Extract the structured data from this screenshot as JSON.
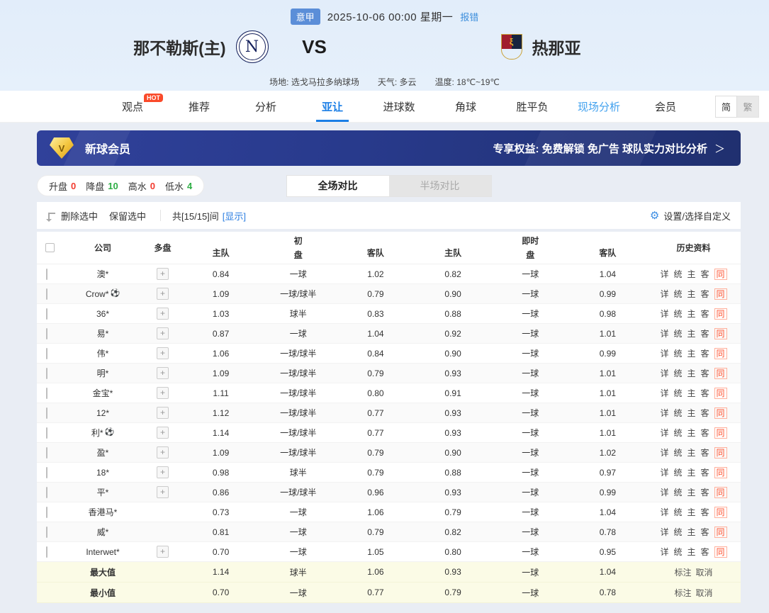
{
  "header": {
    "league_badge": "意甲",
    "match_time": "2025-10-06 00:00 星期一",
    "report_error": "报错",
    "home_team": "那不勒斯(主)",
    "home_logo_letter": "N",
    "vs": "VS",
    "away_team": "热那亚",
    "venue_label": "场地:",
    "venue": "选戈马拉多纳球场",
    "weather_label": "天气:",
    "weather": "多云",
    "temp_label": "温度:",
    "temperature": "18℃~19℃"
  },
  "nav": {
    "hot_badge": "HOT",
    "tabs": [
      {
        "label": "观点",
        "hot": true
      },
      {
        "label": "推荐"
      },
      {
        "label": "分析"
      },
      {
        "label": "亚让",
        "active": true
      },
      {
        "label": "进球数"
      },
      {
        "label": "角球"
      },
      {
        "label": "胜平负"
      },
      {
        "label": "现场分析",
        "highlight": true
      },
      {
        "label": "会员"
      }
    ],
    "lang_simplified": "简",
    "lang_traditional": "繁"
  },
  "banner": {
    "gem_letter": "V",
    "title": "新球会员",
    "benefits": "专享权益: 免费解锁 免广告 球队实力对比分析",
    "arrow": "＞"
  },
  "filters": {
    "items": [
      {
        "label": "升盘",
        "value": "0",
        "tone": "red"
      },
      {
        "label": "降盘",
        "value": "10",
        "tone": "green"
      },
      {
        "label": "高水",
        "value": "0",
        "tone": "red"
      },
      {
        "label": "低水",
        "value": "4",
        "tone": "green"
      }
    ],
    "tab_full": "全场对比",
    "tab_half": "半场对比"
  },
  "toolbar": {
    "delete_selected": "删除选中",
    "keep_selected": "保留选中",
    "count_text": "共[15/15]间",
    "show_link": "[显示]",
    "gear_icon": "⚙",
    "settings": "设置/选择自定义"
  },
  "table": {
    "headers": {
      "company": "公司",
      "multi": "多盘",
      "initial_top": "初",
      "live_top": "即时",
      "handicap": "盘",
      "home": "主队",
      "away": "客队",
      "history": "历史资料"
    },
    "multi_icon": "+",
    "ball_icon": "⚽",
    "history_links": [
      "详",
      "统",
      "主",
      "客"
    ],
    "history_same": "同",
    "rows": [
      {
        "company": "澳*",
        "ball": false,
        "multi": true,
        "init_home": "0.84",
        "init_handicap": "一球",
        "init_away": "1.02",
        "live_home": "0.82",
        "live_handicap": "一球",
        "live_away": "1.04"
      },
      {
        "company": "Crow*",
        "ball": true,
        "multi": true,
        "init_home": "1.09",
        "init_handicap": "一球/球半",
        "init_away": "0.79",
        "live_home": "0.90",
        "live_handicap": "一球",
        "live_away": "0.99"
      },
      {
        "company": "36*",
        "ball": false,
        "multi": true,
        "init_home": "1.03",
        "init_handicap": "球半",
        "init_away": "0.83",
        "live_home": "0.88",
        "live_handicap": "一球",
        "live_away": "0.98"
      },
      {
        "company": "易*",
        "ball": false,
        "multi": true,
        "init_home": "0.87",
        "init_handicap": "一球",
        "init_away": "1.04",
        "live_home": "0.92",
        "live_handicap": "一球",
        "live_away": "1.01"
      },
      {
        "company": "伟*",
        "ball": false,
        "multi": true,
        "init_home": "1.06",
        "init_handicap": "一球/球半",
        "init_away": "0.84",
        "live_home": "0.90",
        "live_handicap": "一球",
        "live_away": "0.99"
      },
      {
        "company": "明*",
        "ball": false,
        "multi": true,
        "init_home": "1.09",
        "init_handicap": "一球/球半",
        "init_away": "0.79",
        "live_home": "0.93",
        "live_handicap": "一球",
        "live_away": "1.01"
      },
      {
        "company": "金宝*",
        "ball": false,
        "multi": true,
        "init_home": "1.11",
        "init_handicap": "一球/球半",
        "init_away": "0.80",
        "live_home": "0.91",
        "live_handicap": "一球",
        "live_away": "1.01"
      },
      {
        "company": "12*",
        "ball": false,
        "multi": true,
        "init_home": "1.12",
        "init_handicap": "一球/球半",
        "init_away": "0.77",
        "live_home": "0.93",
        "live_handicap": "一球",
        "live_away": "1.01"
      },
      {
        "company": "利*",
        "ball": true,
        "multi": true,
        "init_home": "1.14",
        "init_handicap": "一球/球半",
        "init_away": "0.77",
        "live_home": "0.93",
        "live_handicap": "一球",
        "live_away": "1.01"
      },
      {
        "company": "盈*",
        "ball": false,
        "multi": true,
        "init_home": "1.09",
        "init_handicap": "一球/球半",
        "init_away": "0.79",
        "live_home": "0.90",
        "live_handicap": "一球",
        "live_away": "1.02"
      },
      {
        "company": "18*",
        "ball": false,
        "multi": true,
        "init_home": "0.98",
        "init_handicap": "球半",
        "init_away": "0.79",
        "live_home": "0.88",
        "live_handicap": "一球",
        "live_away": "0.97"
      },
      {
        "company": "平*",
        "ball": false,
        "multi": true,
        "init_home": "0.86",
        "init_handicap": "一球/球半",
        "init_away": "0.96",
        "live_home": "0.93",
        "live_handicap": "一球",
        "live_away": "0.99"
      },
      {
        "company": "香港马*",
        "ball": false,
        "multi": false,
        "init_home": "0.73",
        "init_handicap": "一球",
        "init_away": "1.06",
        "live_home": "0.79",
        "live_handicap": "一球",
        "live_away": "1.04"
      },
      {
        "company": "威*",
        "ball": false,
        "multi": false,
        "init_home": "0.81",
        "init_handicap": "一球",
        "init_away": "0.79",
        "live_home": "0.82",
        "live_handicap": "一球",
        "live_away": "0.78"
      },
      {
        "company": "Interwet*",
        "ball": false,
        "multi": true,
        "init_home": "0.70",
        "init_handicap": "一球",
        "init_away": "1.05",
        "live_home": "0.80",
        "live_handicap": "一球",
        "live_away": "0.95"
      }
    ],
    "summary": [
      {
        "label": "最大值",
        "init_home": "1.14",
        "init_handicap": "球半",
        "init_away": "1.06",
        "live_home": "0.93",
        "live_handicap": "一球",
        "live_away": "1.04"
      },
      {
        "label": "最小值",
        "init_home": "0.70",
        "init_handicap": "一球",
        "init_away": "0.77",
        "live_home": "0.79",
        "live_handicap": "一球",
        "live_away": "0.78"
      }
    ],
    "summary_actions": [
      "标注",
      "取消"
    ]
  }
}
